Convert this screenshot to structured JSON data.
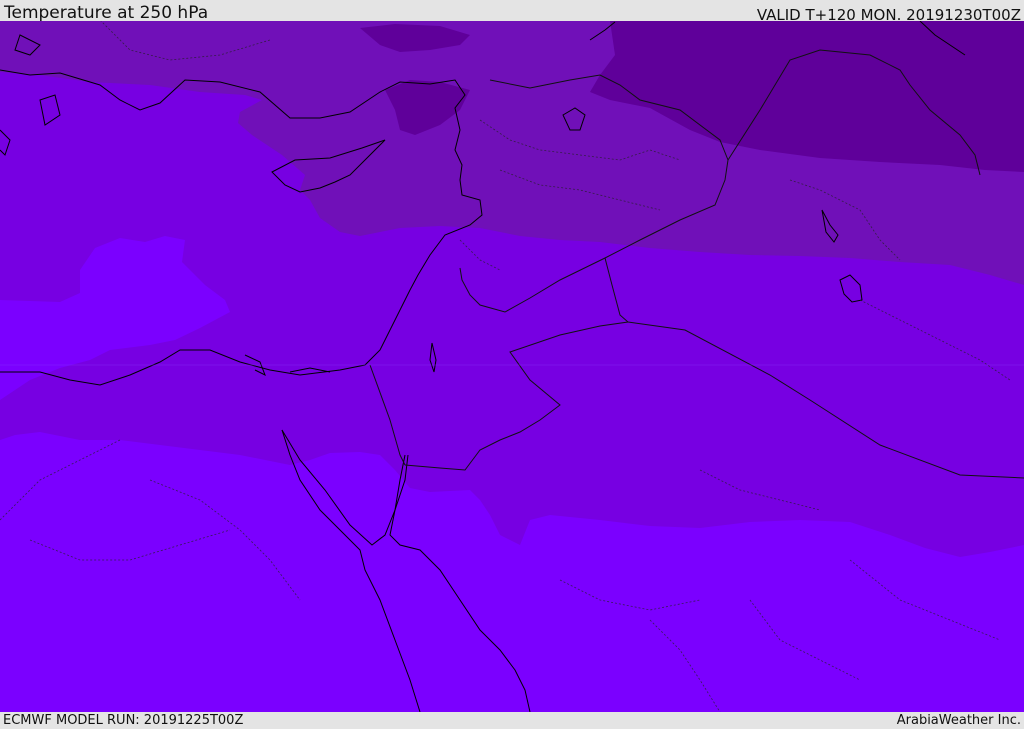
{
  "header": {
    "title": "Temperature at 250 hPa",
    "valid": "VALID T+120 MON. 20191230T00Z"
  },
  "footer": {
    "model_run": "ECMWF MODEL RUN: 20191225T00Z",
    "credit": "ArabiaWeather Inc."
  },
  "map": {
    "region": "Eastern Mediterranean and Middle East",
    "field": "temperature at 250 hPa",
    "colors": {
      "coldest": "#5f009a",
      "cold": "#7010b8",
      "mid": "#7700e2",
      "warm": "#7b00ff",
      "coastline": "#000000",
      "border": "#111111"
    }
  }
}
